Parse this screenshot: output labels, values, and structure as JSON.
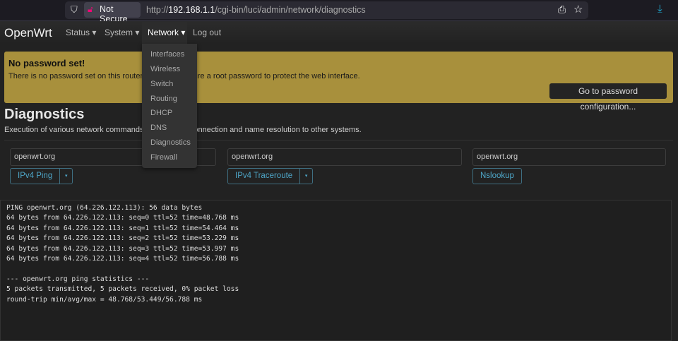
{
  "browser": {
    "security_label": "Not Secure",
    "url_prefix": "http://",
    "url_host": "192.168.1.1",
    "url_path": "/cgi-bin/luci/admin/network/diagnostics",
    "download_color": "#1fb5e0"
  },
  "nav": {
    "brand": "OpenWrt",
    "items": [
      {
        "label": "Status ▾"
      },
      {
        "label": "System ▾"
      },
      {
        "label": "Network ▾"
      },
      {
        "label": "Log out"
      }
    ],
    "active": "Network"
  },
  "network_menu": [
    "Interfaces",
    "Wireless",
    "Switch",
    "Routing",
    "DHCP",
    "DNS",
    "Diagnostics",
    "Firewall"
  ],
  "alert": {
    "title": "No password set!",
    "text": "There is no password set on this router. Please configure a root password to protect the web interface.",
    "button": "Go to password configuration...",
    "color": "#a8903c"
  },
  "page": {
    "title": "Diagnostics",
    "description": "Execution of various network commands to check the connection and name resolution to other systems."
  },
  "tools": [
    {
      "value": "openwrt.org",
      "button": "IPv4 Ping",
      "dropdown": "▾"
    },
    {
      "value": "openwrt.org",
      "button": "IPv4 Traceroute",
      "dropdown": "▾"
    },
    {
      "value": "openwrt.org",
      "button": "Nslookup"
    }
  ],
  "output": "PING openwrt.org (64.226.122.113): 56 data bytes\n64 bytes from 64.226.122.113: seq=0 ttl=52 time=48.768 ms\n64 bytes from 64.226.122.113: seq=1 ttl=52 time=54.464 ms\n64 bytes from 64.226.122.113: seq=2 ttl=52 time=53.229 ms\n64 bytes from 64.226.122.113: seq=3 ttl=52 time=53.997 ms\n64 bytes from 64.226.122.113: seq=4 ttl=52 time=56.788 ms\n\n--- openwrt.org ping statistics ---\n5 packets transmitted, 5 packets received, 0% packet loss\nround-trip min/avg/max = 48.768/53.449/56.788 ms"
}
